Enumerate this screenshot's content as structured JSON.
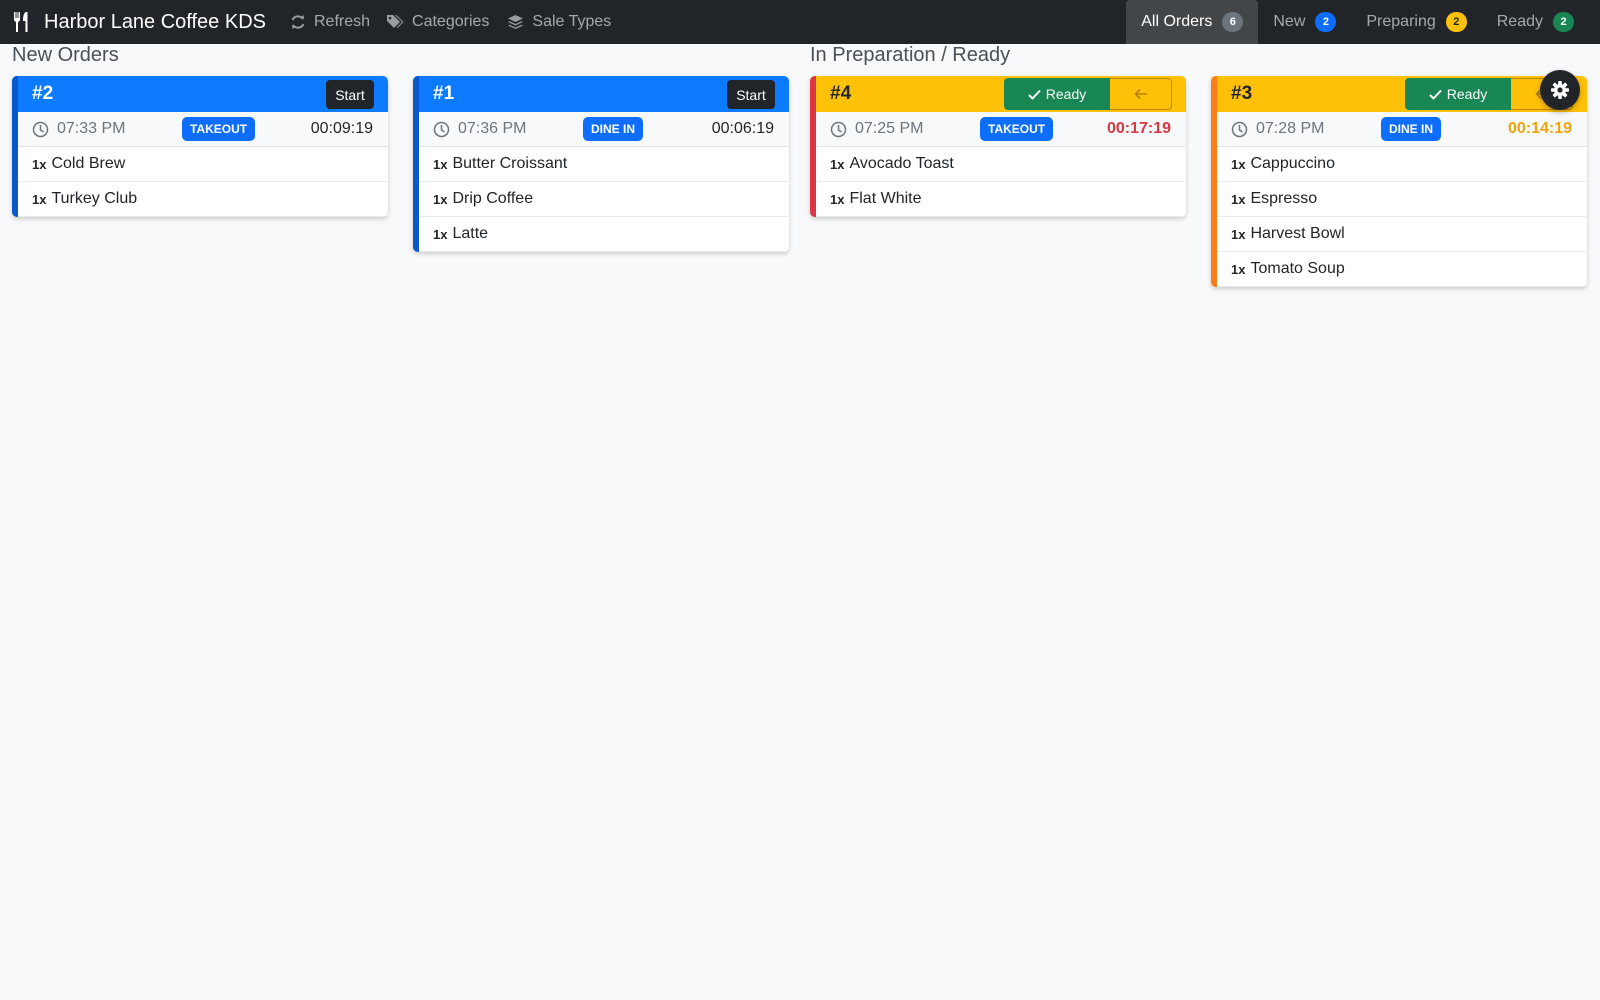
{
  "app": {
    "title": "Harbor Lane Coffee KDS"
  },
  "nav": {
    "refresh": "Refresh",
    "categories": "Categories",
    "sale_types": "Sale Types"
  },
  "filters": [
    {
      "label": "All Orders",
      "count": "6"
    },
    {
      "label": "New",
      "count": "2"
    },
    {
      "label": "Preparing",
      "count": "2"
    },
    {
      "label": "Ready",
      "count": "2"
    }
  ],
  "sections": {
    "new": "New Orders",
    "prep": "In Preparation / Ready"
  },
  "orders": [
    {
      "number": "#2",
      "time": "07:33 PM",
      "type": "TAKEOUT",
      "elapsed": "00:09:19",
      "action": "Start",
      "items": [
        {
          "qty": "1x",
          "name": "Cold Brew"
        },
        {
          "qty": "1x",
          "name": "Turkey Club"
        }
      ]
    },
    {
      "number": "#1",
      "time": "07:36 PM",
      "type": "DINE IN",
      "elapsed": "00:06:19",
      "action": "Start",
      "items": [
        {
          "qty": "1x",
          "name": "Butter Croissant"
        },
        {
          "qty": "1x",
          "name": "Drip Coffee"
        },
        {
          "qty": "1x",
          "name": "Latte"
        }
      ]
    },
    {
      "number": "#4",
      "time": "07:25 PM",
      "type": "TAKEOUT",
      "elapsed": "00:17:19",
      "action": "Ready",
      "items": [
        {
          "qty": "1x",
          "name": "Avocado Toast"
        },
        {
          "qty": "1x",
          "name": "Flat White"
        }
      ]
    },
    {
      "number": "#3",
      "time": "07:28 PM",
      "type": "DINE IN",
      "elapsed": "00:14:19",
      "action": "Ready",
      "items": [
        {
          "qty": "1x",
          "name": "Cappuccino"
        },
        {
          "qty": "1x",
          "name": "Espresso"
        },
        {
          "qty": "1x",
          "name": "Harvest Bowl"
        },
        {
          "qty": "1x",
          "name": "Tomato Soup"
        }
      ]
    }
  ],
  "colors": {
    "new_header": "#0d7bff",
    "prep_header": "#ffc107",
    "overdue": "#dc3545",
    "warning": "#f0a30a"
  }
}
